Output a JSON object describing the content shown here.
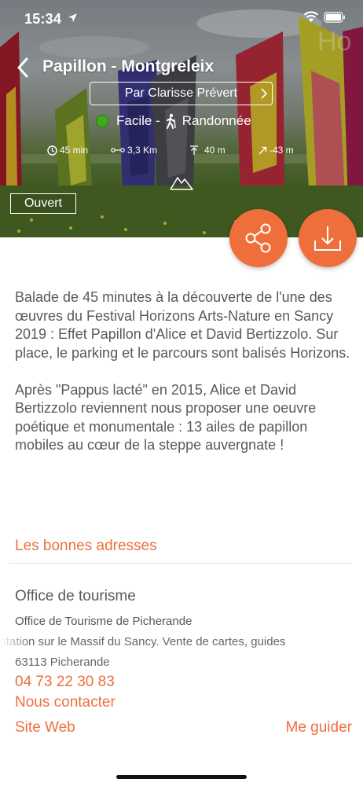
{
  "status_bar": {
    "time": "15:34"
  },
  "header": {
    "title": "Papillon - Montgreleix",
    "author_prefix": "Par",
    "author_name": "Clarisse Prévert",
    "difficulty": "Facile -",
    "activity": "Randonnée",
    "difficulty_color": "#3cab1c"
  },
  "stats": {
    "duration": "45 min",
    "distance": "3,3 Km",
    "ascent": "40 m",
    "descent": "-43 m"
  },
  "status_badge": "Ouvert",
  "icons": {
    "back": "chevron-left-icon",
    "share": "share-icon",
    "download": "download-icon",
    "terrain": "mountains-icon"
  },
  "accent_color": "#ef6f3c",
  "description": {
    "paragraph_1": "Balade de 45 minutes à la découverte de l'une des œuvres du Festival Horizons Arts-Nature en Sancy 2019 : Effet Papillon d'Alice et David Bertizzolo. Sur place, le parking et le parcours sont balisés Horizons.",
    "paragraph_2": "Après \"Pappus lacté\" en 2015, Alice et David Bertizzolo reviennent nous proposer une oeuvre poétique et monumentale : 13 ailes de papillon mobiles au cœur de la steppe auvergnate !"
  },
  "good_addresses": {
    "section_title": "Les bonnes adresses",
    "office_title": "Office de tourisme",
    "office_name": "Office de Tourisme de Picherande",
    "office_desc": "entation sur le Massif du Sancy. Vente de cartes, guides",
    "office_address": "63113 Picherande",
    "phone": "04 73 22 30 83",
    "contact_label": "Nous contacter",
    "website_label": "Site Web",
    "guide_label": "Me guider"
  }
}
